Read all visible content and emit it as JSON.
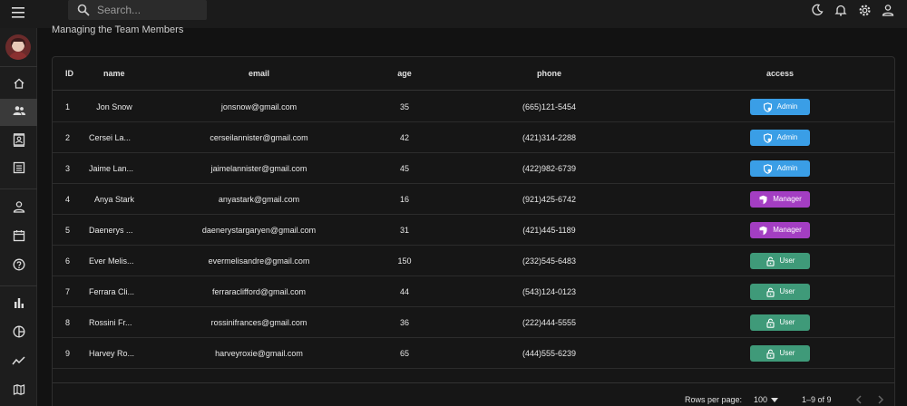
{
  "search": {
    "placeholder": "Search..."
  },
  "page": {
    "subtitle": "Managing the Team Members"
  },
  "table": {
    "columns": [
      "ID",
      "name",
      "email",
      "age",
      "phone",
      "access"
    ],
    "rows": [
      {
        "id": "1",
        "name": "Jon Snow",
        "email": "jonsnow@gmail.com",
        "age": "35",
        "phone": "(665)121-5454",
        "access": "Admin"
      },
      {
        "id": "2",
        "name": "Cersei La...",
        "email": "cerseilannister@gmail.com",
        "age": "42",
        "phone": "(421)314-2288",
        "access": "Admin"
      },
      {
        "id": "3",
        "name": "Jaime Lan...",
        "email": "jaimelannister@gmail.com",
        "age": "45",
        "phone": "(422)982-6739",
        "access": "Admin"
      },
      {
        "id": "4",
        "name": "Anya Stark",
        "email": "anyastark@gmail.com",
        "age": "16",
        "phone": "(921)425-6742",
        "access": "Manager"
      },
      {
        "id": "5",
        "name": "Daenerys ...",
        "email": "daenerystargaryen@gmail.com",
        "age": "31",
        "phone": "(421)445-1189",
        "access": "Manager"
      },
      {
        "id": "6",
        "name": "Ever Melis...",
        "email": "evermelisandre@gmail.com",
        "age": "150",
        "phone": "(232)545-6483",
        "access": "User"
      },
      {
        "id": "7",
        "name": "Ferrara Cli...",
        "email": "ferraraclifford@gmail.com",
        "age": "44",
        "phone": "(543)124-0123",
        "access": "User"
      },
      {
        "id": "8",
        "name": "Rossini Fr...",
        "email": "rossinifrances@gmail.com",
        "age": "36",
        "phone": "(222)444-5555",
        "access": "User"
      },
      {
        "id": "9",
        "name": "Harvey Ro...",
        "email": "harveyroxie@gmail.com",
        "age": "65",
        "phone": "(444)555-6239",
        "access": "User"
      }
    ]
  },
  "pagination": {
    "rows_per_page_label": "Rows per page:",
    "rows_per_page": "100",
    "range": "1–9 of 9"
  },
  "colors": {
    "admin": "#3a9ee6",
    "manager": "#a33ec2",
    "user": "#3f9a79"
  },
  "icons": {
    "topbar": [
      "menu-icon",
      "search-icon",
      "dark-mode-icon",
      "notifications-icon",
      "settings-icon",
      "person-icon"
    ],
    "sidebar": [
      "home-icon",
      "team-icon",
      "contacts-icon",
      "invoices-icon",
      "profile-icon",
      "calendar-icon",
      "help-icon",
      "bar-chart-icon",
      "pie-chart-icon",
      "line-chart-icon",
      "map-icon"
    ]
  }
}
